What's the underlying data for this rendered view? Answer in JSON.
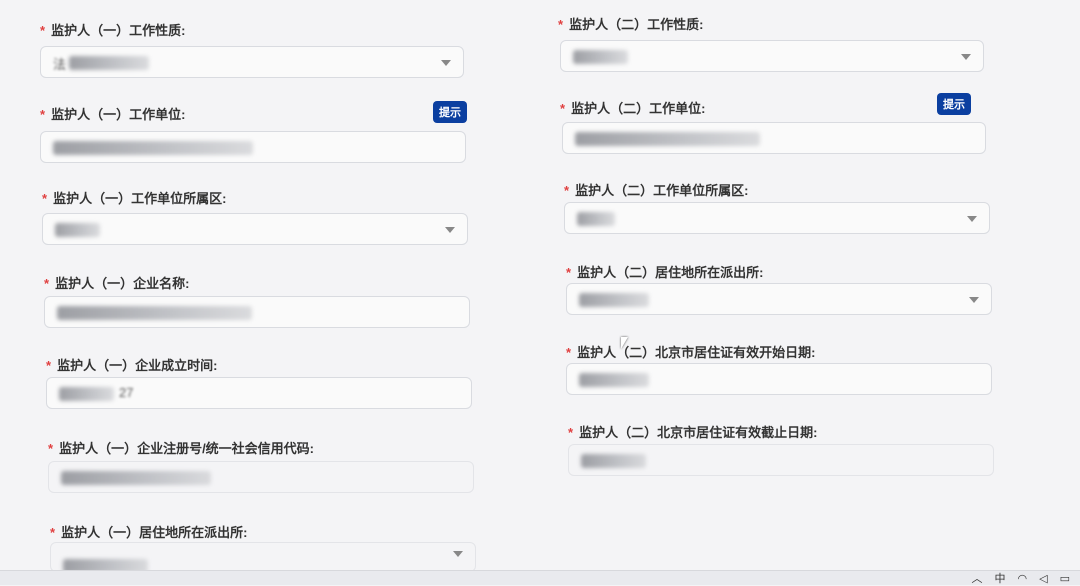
{
  "colors": {
    "required": "#e04040",
    "hint_button": "#0b3fa0"
  },
  "left": {
    "fields": [
      {
        "label": "监护人（一）工作性质:",
        "type": "select",
        "value": "法"
      },
      {
        "label": "监护人（一）工作单位:",
        "type": "input",
        "value": "",
        "hint": "提示"
      },
      {
        "label": "监护人（一）工作单位所属区:",
        "type": "select",
        "value": ""
      },
      {
        "label": "监护人（一）企业名称:",
        "type": "input",
        "value": ""
      },
      {
        "label": "监护人（一）企业成立时间:",
        "type": "input",
        "value": "27"
      },
      {
        "label": "监护人（一）企业注册号/统一社会信用代码:",
        "type": "input",
        "value": ""
      },
      {
        "label": "监护人（一）居住地所在派出所:",
        "type": "select",
        "value": ""
      }
    ]
  },
  "right": {
    "fields": [
      {
        "label": "监护人（二）工作性质:",
        "type": "select",
        "value": ""
      },
      {
        "label": "监护人（二）工作单位:",
        "type": "input",
        "value": "",
        "hint": "提示"
      },
      {
        "label": "监护人（二）工作单位所属区:",
        "type": "select",
        "value": ""
      },
      {
        "label": "监护人（二）居住地所在派出所:",
        "type": "select",
        "value": ""
      },
      {
        "label": "监护人（二）北京市居住证有效开始日期:",
        "type": "input",
        "value": ""
      },
      {
        "label": "监护人（二）北京市居住证有效截止日期:",
        "type": "input",
        "value": ""
      }
    ]
  },
  "tray": {
    "ime": "中"
  },
  "icons": [
    "chevron-down-icon",
    "wifi-icon",
    "speaker-icon",
    "battery-icon",
    "up-arrow-icon"
  ]
}
